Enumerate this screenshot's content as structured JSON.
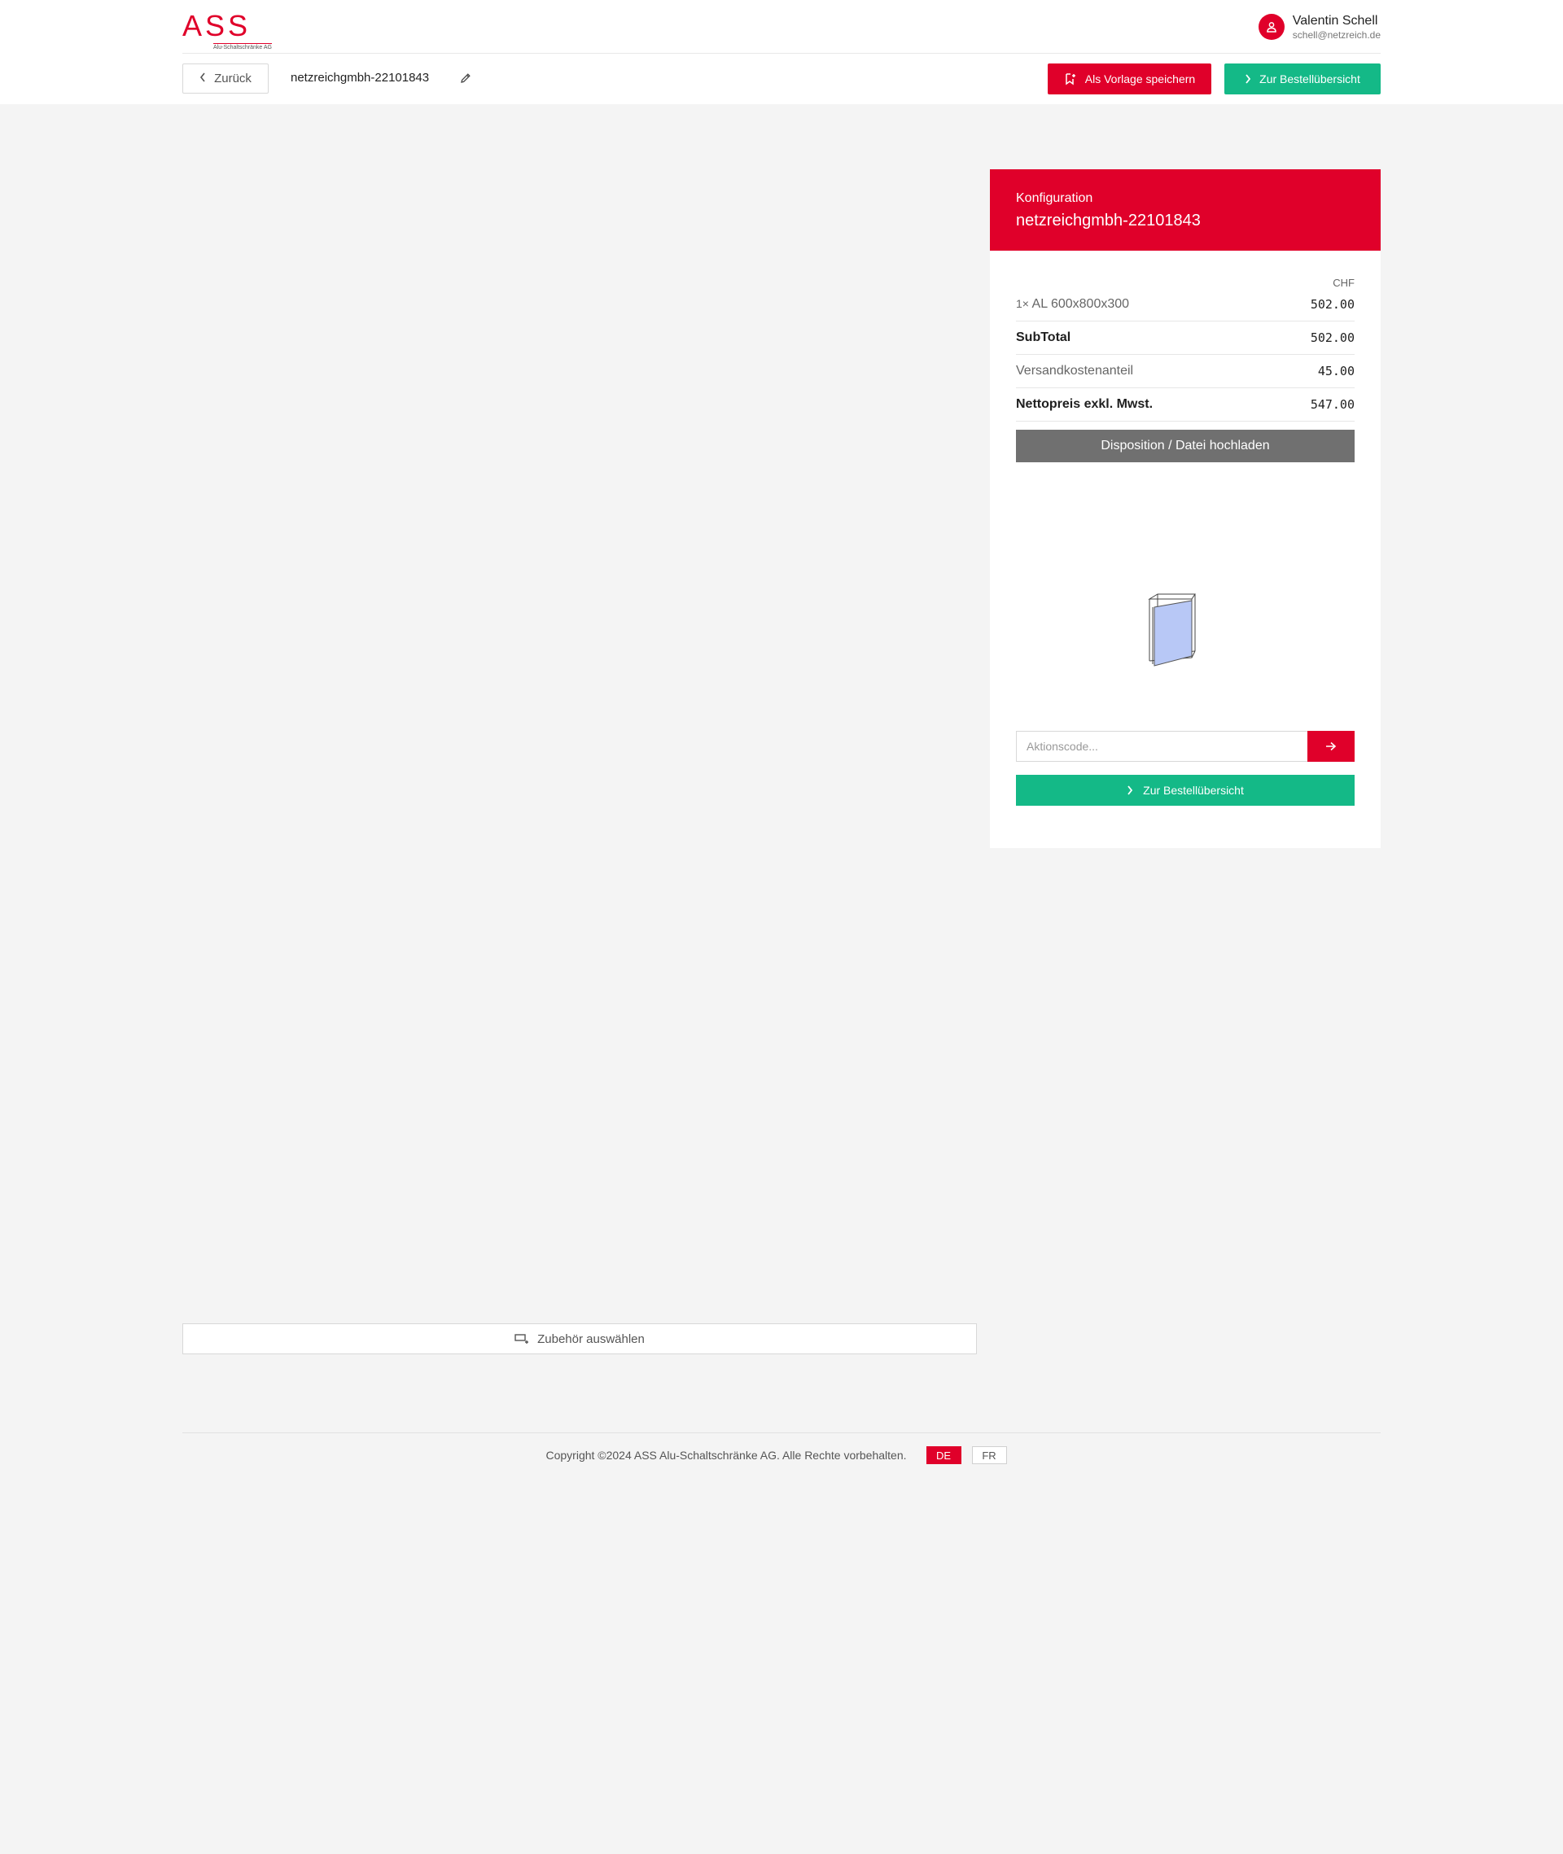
{
  "brand": {
    "logo_letters": "ASS",
    "logo_subtitle": "Alu-Schaltschränke AG",
    "accent_color": "#e0002a",
    "success_color": "#14b987"
  },
  "user": {
    "name": "Valentin Schell",
    "email": "schell@netzreich.de",
    "icon": "user-icon"
  },
  "toolbar": {
    "back_label": "Zurück",
    "config_name": "netzreichgmbh-22101843",
    "save_template_label": "Als Vorlage speichern",
    "order_overview_label": "Zur Bestellübersicht"
  },
  "accessories": {
    "select_label": "Zubehör auswählen"
  },
  "summary": {
    "kicker": "Konfiguration",
    "title": "netzreichgmbh-22101843",
    "currency": "CHF",
    "rows": [
      {
        "qty": "1×",
        "label": "AL 600x800x300",
        "value": "502.00"
      },
      {
        "label": "SubTotal",
        "value": "502.00"
      },
      {
        "label": "Versandkostenanteil",
        "value": "45.00"
      },
      {
        "label": "Nettopreis exkl. Mwst.",
        "value": "547.00"
      }
    ],
    "upload_label": "Disposition / Datei hochladen",
    "promo_placeholder": "Aktionscode...",
    "order_label": "Zur Bestellübersicht"
  },
  "footer": {
    "copyright": "Copyright ©2024 ASS Alu-Schaltschränke AG. Alle Rechte vorbehalten.",
    "languages": [
      "DE",
      "FR"
    ],
    "active_language": "DE"
  }
}
